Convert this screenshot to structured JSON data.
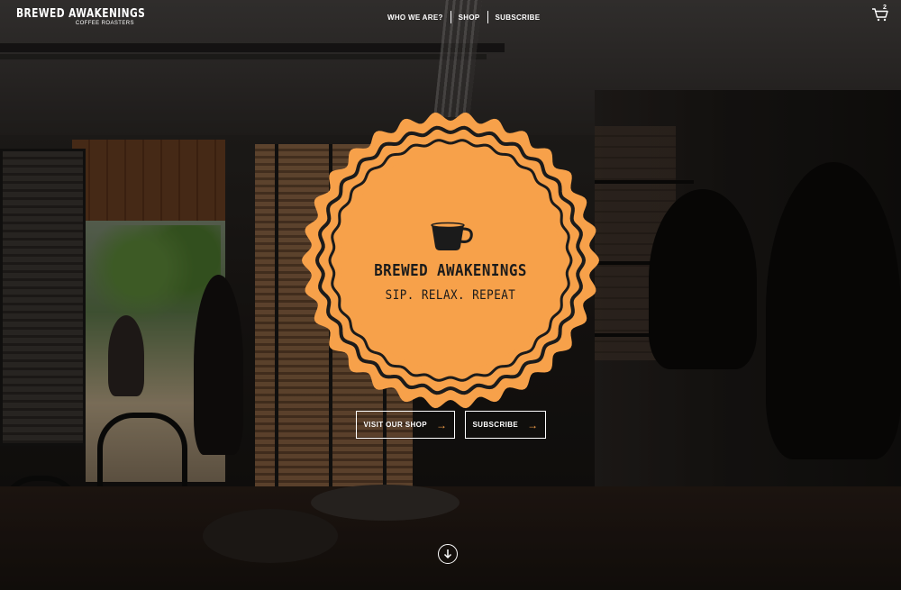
{
  "brand": {
    "name": "BREWED AWAKENINGS",
    "subtitle": "COFFEE ROASTERS",
    "emblem_title": "BREWED AWAKENINGS",
    "tagline": "SIP. RELAX. REPEAT",
    "accent_color": "#F7A14A",
    "ink_color": "#1B1B1B"
  },
  "nav": {
    "items": [
      {
        "label": "WHO WE ARE?"
      },
      {
        "label": "SHOP"
      },
      {
        "label": "SUBSCRIBE"
      }
    ]
  },
  "cart": {
    "icon": "cart-icon",
    "count": "2"
  },
  "hero": {
    "buttons": [
      {
        "label": "VISIT OUR SHOP",
        "icon": "arrow-right-icon"
      },
      {
        "label": "SUBSCRIBE",
        "icon": "arrow-right-icon"
      }
    ],
    "scroll_icon": "arrow-down-circle-icon",
    "emblem_icon": "coffee-cup-icon"
  }
}
